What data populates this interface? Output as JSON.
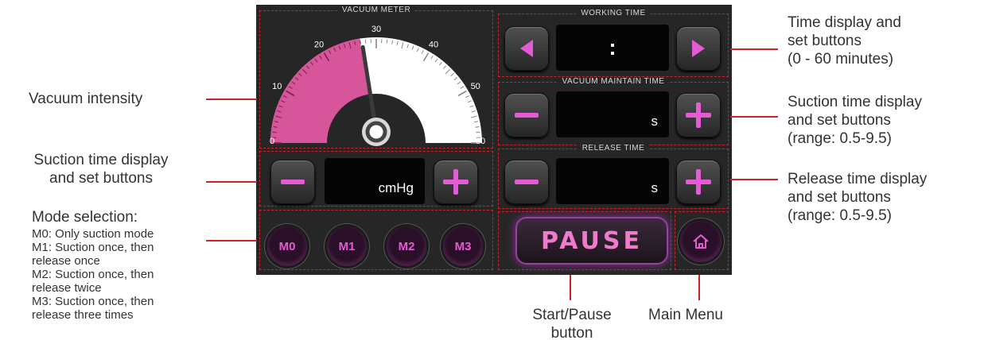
{
  "panel": {
    "vacuum_meter": {
      "title": "VACUUM METER",
      "scale_labels": [
        "0",
        "10",
        "20",
        "30",
        "40",
        "50",
        "60"
      ],
      "reading_fraction": 0.45
    },
    "vacuum_set": {
      "value": "",
      "unit": "cmHg"
    },
    "working_time": {
      "title": "WORKING TIME",
      "value": ":"
    },
    "vacuum_maintain_time": {
      "title": "VACUUM MAINTAIN TIME",
      "value": "",
      "unit": "s"
    },
    "release_time": {
      "title": "RELEASE TIME",
      "value": "",
      "unit": "s"
    },
    "modes": [
      {
        "label": "M0"
      },
      {
        "label": "M1"
      },
      {
        "label": "M2"
      },
      {
        "label": "M3"
      }
    ],
    "pause_label": "PAUSE",
    "colors": {
      "accent": "#e55bd6",
      "panel": "#262626",
      "callout_line": "#d0222b"
    }
  },
  "annotations": {
    "vacuum_intensity": "Vacuum intensity",
    "suction_left_line1": "Suction time display",
    "suction_left_line2": "and set buttons",
    "mode_title": "Mode selection:",
    "mode_lines": [
      "M0: Only suction mode",
      "M1: Suction once, then",
      "release once",
      "M2: Suction once, then",
      "release twice",
      "M3: Suction once, then",
      "release three times"
    ],
    "time_display": [
      "Time display and",
      "set buttons",
      "(0 - 60 minutes)"
    ],
    "suction_right": [
      "Suction time display",
      "and set buttons",
      "(range: 0.5-9.5)"
    ],
    "release_right": [
      "Release time display",
      "and set buttons",
      "(range: 0.5-9.5)"
    ],
    "start_pause": [
      "Start/Pause",
      "button"
    ],
    "main_menu": "Main Menu"
  }
}
